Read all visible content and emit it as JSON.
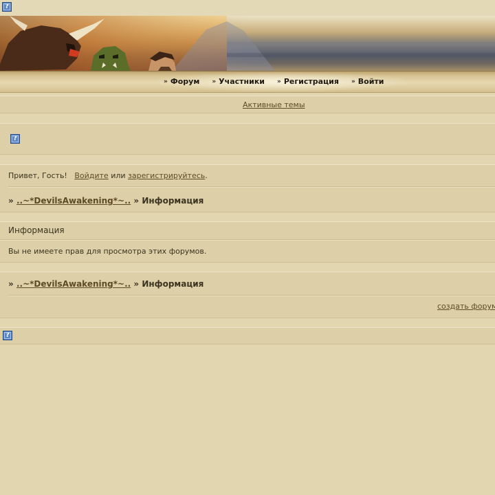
{
  "icons": {
    "help": "help-question-icon",
    "glyph": "?",
    "nav_arrow": "»"
  },
  "colors": {
    "background": "#e2d6b0",
    "panel": "#ddd0a8",
    "link": "#5e4a26",
    "text": "#3a3320",
    "help_icon": "#5b86c6"
  },
  "nav": {
    "items": [
      {
        "label": "Форум"
      },
      {
        "label": "Участники"
      },
      {
        "label": "Регистрация"
      },
      {
        "label": "Войти"
      }
    ]
  },
  "active_topics": "Активные темы",
  "welcome": {
    "greeting": "Привет, Гость!",
    "login_link": "Войдите",
    "or_text": "или",
    "register_link": "зарегистрируйтесь",
    "end": "."
  },
  "breadcrumb": {
    "prefix": "»",
    "forum_name": "..~*DevilsAwakening*~..",
    "separator": "»",
    "current": "Информация"
  },
  "info": {
    "title": "Информация",
    "message": "Вы не имеете прав для просмотра этих форумов."
  },
  "footer": {
    "create_forum": "создать форум"
  }
}
